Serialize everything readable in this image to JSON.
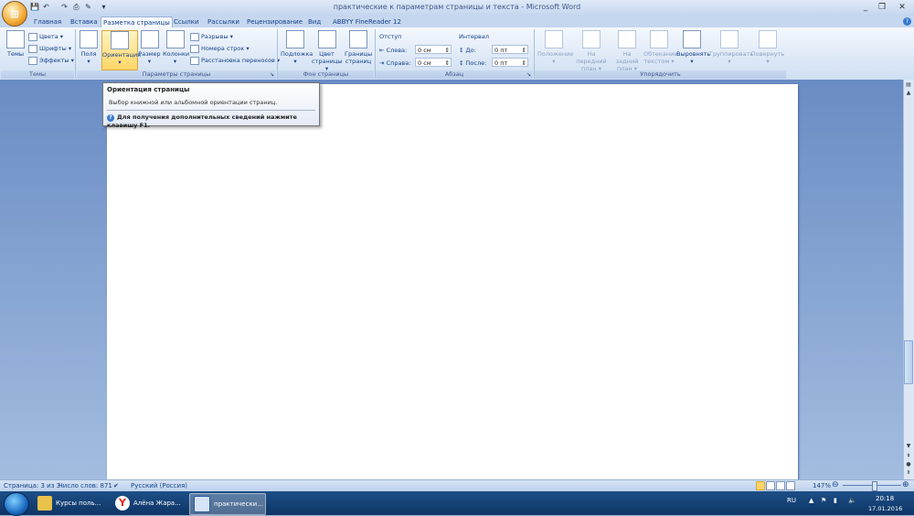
{
  "window": {
    "title": "практические к параметрам страницы и текста - Microsoft Word",
    "controls": [
      "_",
      "❐",
      "✕"
    ]
  },
  "qat": [
    "💾",
    "↶",
    "↷",
    "⎙",
    "✎",
    "▾"
  ],
  "tabs": [
    "Главная",
    "Вставка",
    "Разметка страницы",
    "Ссылки",
    "Рассылки",
    "Рецензирование",
    "Вид",
    "ABBYY FineReader 12"
  ],
  "ribbon": {
    "themes": {
      "big_label": "Темы",
      "colors": "Цвета",
      "fonts": "Шрифты",
      "effects": "Эффекты",
      "group_label": "Темы"
    },
    "page_setup": {
      "margins": "Поля",
      "orientation": "Ориентация",
      "size": "Размер",
      "columns": "Колонки",
      "breaks": "Разрывы",
      "line_numbers": "Номера строк",
      "hyphenation": "Расстановка переносов",
      "group_label": "Параметры страницы"
    },
    "page_background": {
      "watermark": "Подложка",
      "page_color_1": "Цвет",
      "page_color_2": "страницы",
      "page_borders_1": "Границы",
      "page_borders_2": "страниц",
      "group_label": "Фон страницы"
    },
    "paragraph": {
      "indent_title": "Отступ",
      "left_label": "Слева:",
      "left_value": "0 см",
      "right_label": "Справа:",
      "right_value": "0 см",
      "spacing_title": "Интервал",
      "before_label": "До:",
      "before_value": "0 пт",
      "after_label": "После:",
      "after_value": "0 пт",
      "group_label": "Абзац"
    },
    "arrange": {
      "position": "Положение",
      "front_1": "На передний",
      "front_2": "план",
      "back_1": "На задний",
      "back_2": "план",
      "wrap_1": "Обтекание",
      "wrap_2": "текстом",
      "align": "Выровнять",
      "group": "Группировать",
      "rotate": "Повернуть",
      "group_label": "Упорядочить"
    }
  },
  "tooltip": {
    "title": "Ориентация страницы",
    "description": "Выбор книжной или альбомной ориентации страниц.",
    "help": "Для получения дополнительных сведений нажмите клавишу F1."
  },
  "statusbar": {
    "page": "Страница: 3 из 3",
    "words": "Число слов: 871",
    "language": "Русский (Россия)",
    "zoom": "147%"
  },
  "taskbar": {
    "items": [
      "Курсы поль...",
      "Алёна Жара...",
      "практически..."
    ],
    "lang": "RU",
    "time": "20:18",
    "date": "17.01.2016"
  },
  "colors": {
    "accent": "#15428b",
    "ribbon_bg": "#dde8f6",
    "highlight": "#ffd566"
  }
}
